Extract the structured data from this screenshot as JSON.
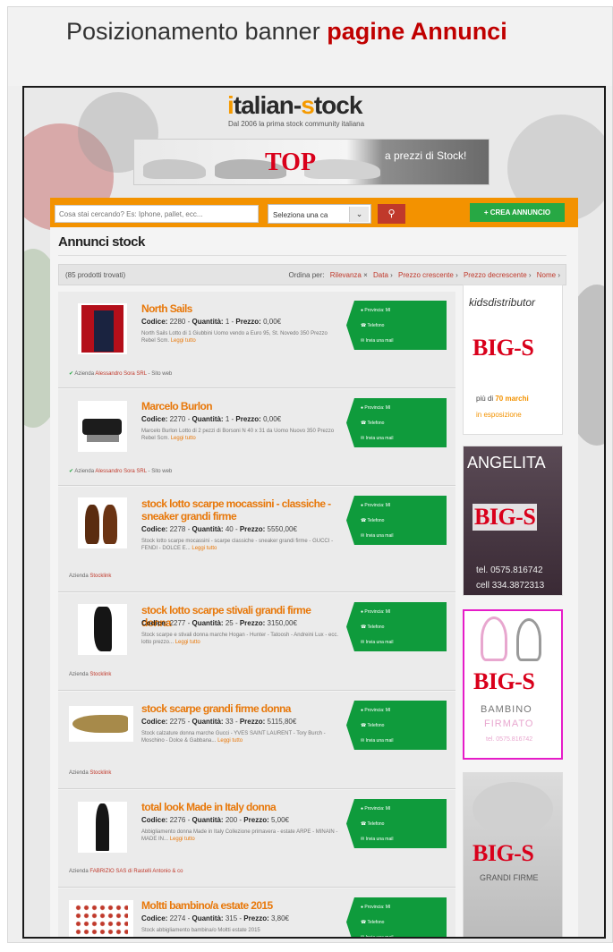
{
  "header": {
    "title_prefix": "Posizionamento banner",
    "title_highlight": "pagine Annunci"
  },
  "site": {
    "logo_part1": "i",
    "logo_part2": "talian-",
    "logo_part3": "s",
    "logo_part4": "tock",
    "tagline": "Dal 2006 la prima stock community italiana",
    "top_banner": {
      "text": "TOP",
      "sub": "a prezzi di Stock!"
    },
    "search": {
      "placeholder": "Cosa stai cercando? Es: Iphone, pallet, ecc...",
      "category_label": "Seleziona una ca",
      "crea_label": "+ CREA ANNUNCIO"
    },
    "page_title": "Annunci stock",
    "result_count": "(85 prodotti trovati)",
    "sort": {
      "label": "Ordina per:",
      "options": [
        "Rilevanza",
        "Data",
        "Prezzo crescente",
        "Prezzo decrescente",
        "Nome"
      ]
    },
    "green_box": {
      "line1": "Provincia: MI",
      "line2": "Telefono",
      "line3": "Invia una mail"
    },
    "listings": [
      {
        "title": "North Sails",
        "code": "2280",
        "qty": "1",
        "price": "0,00€",
        "desc": "North Sails Lotto di 1 Giubbini Uomo vendo a Euro 95, St. Novedo 350 Prezzo Rebel Scm.",
        "more": "Leggi tutto",
        "seller_label": "Azienda",
        "seller": "Alessandro Sora SRL",
        "seller_extra": "Sito web",
        "verified": true
      },
      {
        "title": "Marcelo Burlon",
        "code": "2270",
        "qty": "1",
        "price": "0,00€",
        "desc": "Marcelo Burlon Lotto di 2 pezzi di Borsoni N 40 x 31 da Uomo Nuovo 350 Prezzo Rebel Scm.",
        "more": "Leggi tutto",
        "seller_label": "Azienda",
        "seller": "Alessandro Sora SRL",
        "seller_extra": "Sito web",
        "verified": true
      },
      {
        "title": "stock lotto scarpe mocassini - classiche - sneaker grandi firme",
        "code": "2278",
        "qty": "40",
        "price": "5550,00€",
        "desc": "Stock lotto scarpe mocassini - scarpe classiche - sneaker grandi firme - GUCCI - FENDI - DOLCE E...",
        "more": "Leggi tutto",
        "seller_label": "Azienda",
        "seller": "Stocklink",
        "seller_extra": "",
        "verified": false
      },
      {
        "title": "stock lotto scarpe stivali grandi firme donna",
        "code": "2277",
        "qty": "25",
        "price": "3150,00€",
        "desc": "Stock scarpe e stivali donna marche Hogan - Hunter - Tatoosh - Andreini Lux - ecc. lotto prezzo...",
        "more": "Leggi tutto",
        "seller_label": "Azienda",
        "seller": "Stocklink",
        "seller_extra": "",
        "verified": false
      },
      {
        "title": "stock scarpe grandi firme donna",
        "code": "2275",
        "qty": "33",
        "price": "5115,80€",
        "desc": "Stock calzature donna marche Gucci - YVES SAINT LAURENT - Tory Burch - Moschino - Dolce & Gabbana...",
        "more": "Leggi tutto",
        "seller_label": "Azienda",
        "seller": "Stocklink",
        "seller_extra": "",
        "verified": false
      },
      {
        "title": "total look Made in Italy donna",
        "code": "2276",
        "qty": "200",
        "price": "5,00€",
        "desc": "Abbigliamento donna Made in Italy Collezione primavera - estate ARPE - MINAIN - MADE IN...",
        "more": "Leggi tutto",
        "seller_label": "Azienda",
        "seller": "FABRIZIO SAS di Rastelli Antonio & co",
        "seller_extra": "",
        "verified": false
      },
      {
        "title": "Moltti bambino/a estate 2015",
        "code": "2274",
        "qty": "315",
        "price": "3,80€",
        "desc": "Stock abbigliamento bambina/o Moltti estate 2015",
        "more": "",
        "seller_label": "",
        "seller": "",
        "seller_extra": "",
        "verified": false
      }
    ],
    "ads": [
      {
        "top_text": "kidsdistributor",
        "bigs": "BIG-S",
        "line1": "più di",
        "line1b": "70 marchi",
        "line2": "in esposizione"
      },
      {
        "top_text": "ANGELITA",
        "bigs": "BIG-S",
        "line1": "tel. 0575.816742",
        "line2": "cell 334.3872313"
      },
      {
        "bigs": "BIG-S",
        "line1": "BAMBINO",
        "line2": "FIRMATO",
        "line3": "tel. 0575.816742"
      },
      {
        "bigs": "BIG-S",
        "line1": "GRANDI FIRME"
      }
    ]
  }
}
